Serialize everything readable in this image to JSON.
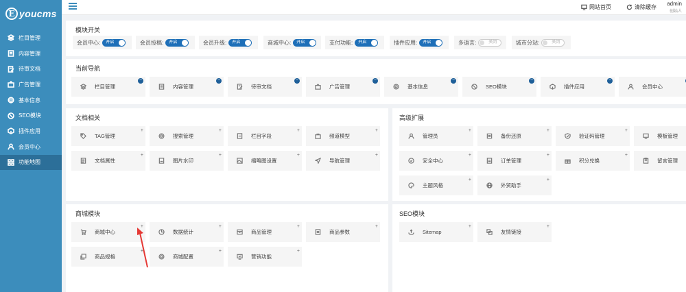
{
  "brand": {
    "logo_letter": "E",
    "logo_text": "youcms"
  },
  "sidebar": {
    "items": [
      {
        "label": "栏目管理",
        "icon": "layers-icon"
      },
      {
        "label": "内容管理",
        "icon": "document-icon"
      },
      {
        "label": "待审文档",
        "icon": "edit-doc-icon"
      },
      {
        "label": "广告管理",
        "icon": "ad-icon"
      },
      {
        "label": "基本信息",
        "icon": "gear-icon"
      },
      {
        "label": "SEO模块",
        "icon": "seo-icon"
      },
      {
        "label": "插件应用",
        "icon": "plugin-icon"
      },
      {
        "label": "会员中心",
        "icon": "user-icon"
      },
      {
        "label": "功能地图",
        "icon": "grid-icon",
        "active": true
      }
    ]
  },
  "topbar": {
    "site_home": "网站首页",
    "clear_cache": "清除缓存",
    "admin_name": "admin",
    "admin_role": "创始人"
  },
  "module_switch": {
    "title": "模块开关",
    "items": [
      {
        "label": "会员中心:",
        "state": "开启",
        "on": true
      },
      {
        "label": "会员投稿:",
        "state": "开启",
        "on": true
      },
      {
        "label": "会员升级:",
        "state": "开启",
        "on": true
      },
      {
        "label": "商城中心:",
        "state": "开启",
        "on": true
      },
      {
        "label": "支付功能:",
        "state": "开启",
        "on": true
      },
      {
        "label": "插件应用:",
        "state": "开启",
        "on": true
      },
      {
        "label": "多语言:",
        "state": "关闭",
        "on": false
      },
      {
        "label": "城市分站:",
        "state": "关闭",
        "on": false
      }
    ]
  },
  "current_nav": {
    "title": "当前导航",
    "items": [
      {
        "label": "栏目管理",
        "icon": "layers-icon"
      },
      {
        "label": "内容管理",
        "icon": "document-icon"
      },
      {
        "label": "待审文档",
        "icon": "edit-doc-icon"
      },
      {
        "label": "广告管理",
        "icon": "ad-icon"
      },
      {
        "label": "基本信息",
        "icon": "gear-icon"
      },
      {
        "label": "SEO模块",
        "icon": "seo-icon"
      },
      {
        "label": "插件应用",
        "icon": "plugin-icon"
      },
      {
        "label": "会员中心",
        "icon": "user-icon"
      }
    ],
    "badge": "−"
  },
  "doc_section": {
    "title": "文档相关",
    "items": [
      {
        "label": "TAG管理",
        "icon": "tag-icon"
      },
      {
        "label": "搜索管理",
        "icon": "search-icon"
      },
      {
        "label": "栏目字段",
        "icon": "field-icon"
      },
      {
        "label": "频道模型",
        "icon": "tv-icon"
      },
      {
        "label": "文档属性",
        "icon": "list-icon"
      },
      {
        "label": "图片水印",
        "icon": "watermark-icon"
      },
      {
        "label": "缩略图设置",
        "icon": "image-icon"
      },
      {
        "label": "导航管理",
        "icon": "navigate-icon"
      }
    ],
    "badge": "+"
  },
  "advanced_section": {
    "title": "高级扩展",
    "items": [
      {
        "label": "管理员",
        "icon": "admin-icon"
      },
      {
        "label": "备份还原",
        "icon": "backup-icon"
      },
      {
        "label": "验证码管理",
        "icon": "shield-icon"
      },
      {
        "label": "模板管理",
        "icon": "monitor-icon"
      },
      {
        "label": "安全中心",
        "icon": "security-icon"
      },
      {
        "label": "订单管理",
        "icon": "order-icon"
      },
      {
        "label": "积分兑换",
        "icon": "gift-icon"
      },
      {
        "label": "留言管理",
        "icon": "message-icon"
      },
      {
        "label": "主题风格",
        "icon": "theme-icon"
      },
      {
        "label": "外贸助手",
        "icon": "globe-icon"
      }
    ],
    "badge": "+"
  },
  "shop_section": {
    "title": "商城模块",
    "items": [
      {
        "label": "商城中心",
        "icon": "cart-icon"
      },
      {
        "label": "数据统计",
        "icon": "pie-icon"
      },
      {
        "label": "商品管理",
        "icon": "box-icon"
      },
      {
        "label": "商品参数",
        "icon": "params-icon"
      },
      {
        "label": "商品规格",
        "icon": "spec-icon"
      },
      {
        "label": "商城配置",
        "icon": "config-icon"
      },
      {
        "label": "营销功能",
        "icon": "marketing-icon"
      }
    ],
    "badge": "+"
  },
  "seo_section": {
    "title": "SEO模块",
    "items": [
      {
        "label": "Sitemap",
        "icon": "sitemap-icon"
      },
      {
        "label": "友情链接",
        "icon": "link-icon"
      }
    ],
    "badge": "+"
  },
  "colors": {
    "sidebar": "#3c8dbc",
    "toggle_on": "#1e6fb8",
    "annotation_arrow": "#e53935"
  }
}
